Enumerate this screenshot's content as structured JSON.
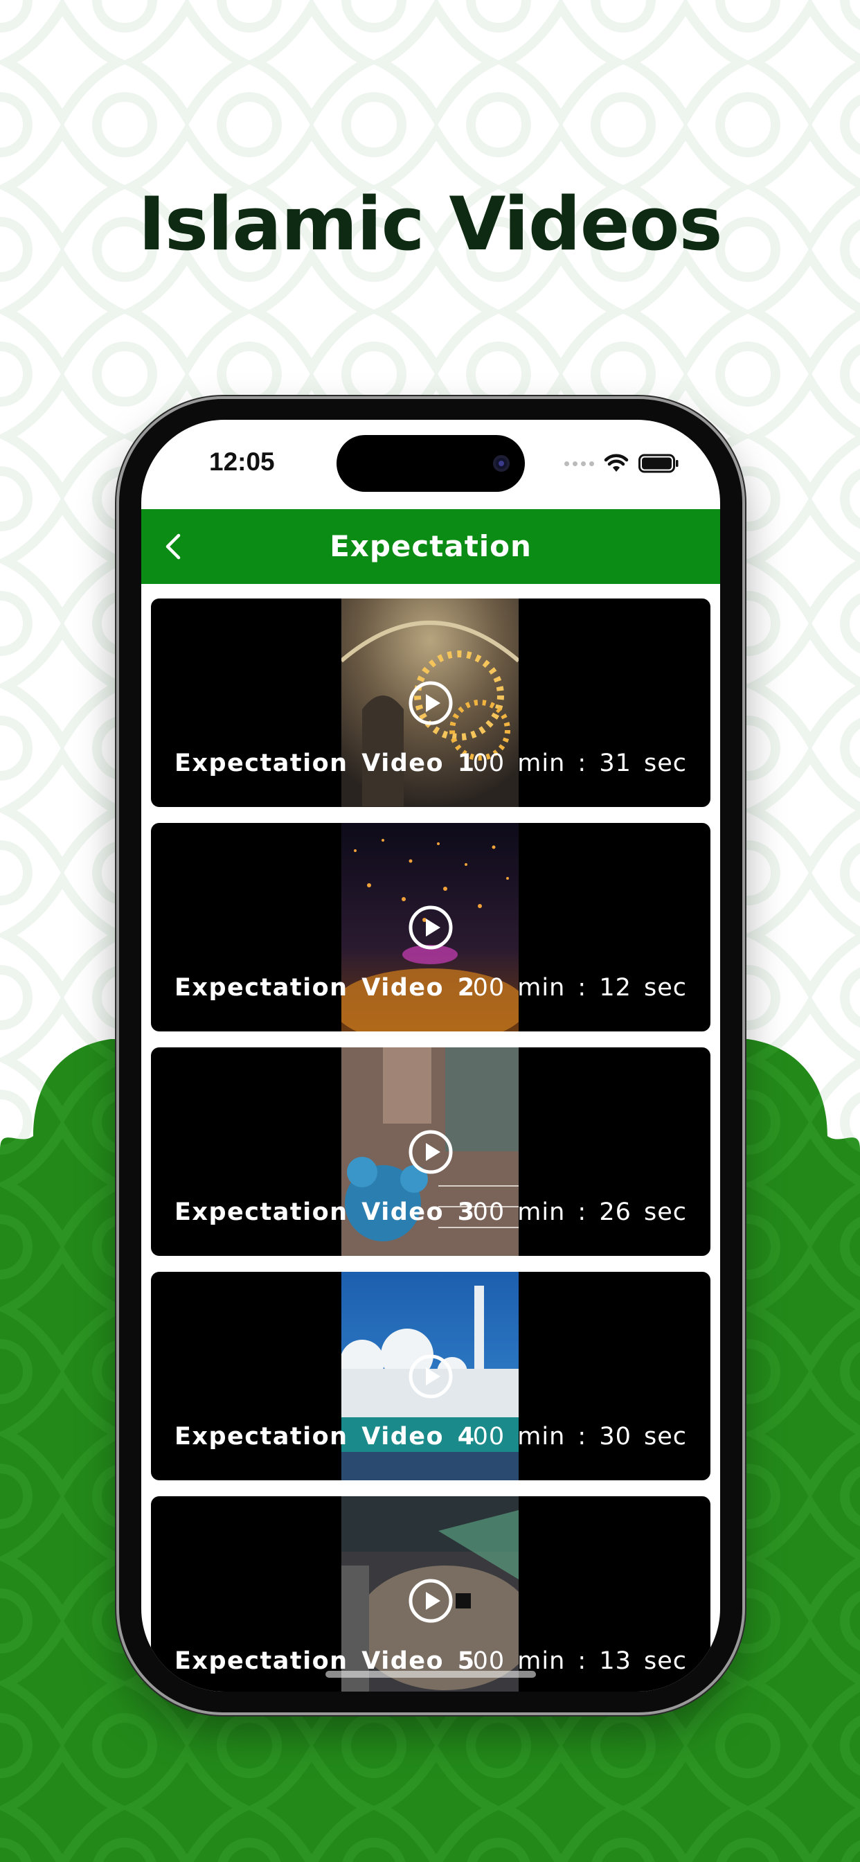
{
  "headline": "Islamic Videos",
  "colors": {
    "brand_green": "#0b8c14",
    "background_green": "#238a1a",
    "headline_color": "#0f2a12",
    "card_background": "#000000"
  },
  "status_bar": {
    "time": "12:05"
  },
  "app_bar": {
    "title": "Expectation",
    "back_icon": "chevron-left-icon"
  },
  "videos": [
    {
      "title": "Expectation Video 1",
      "duration": "00 min : 31 sec",
      "thumbnail": "mosque interior with chandelier"
    },
    {
      "title": "Expectation Video 2",
      "duration": "00 min : 12 sec",
      "thumbnail": "sky lanterns at night"
    },
    {
      "title": "Expectation Video 3",
      "duration": "00 min : 26 sec",
      "thumbnail": "aerial view of blue domed mosque"
    },
    {
      "title": "Expectation Video 4",
      "duration": "00 min : 30 sec",
      "thumbnail": "white mosque with minarets"
    },
    {
      "title": "Expectation Video 5",
      "duration": "00 min : 13 sec",
      "thumbnail": "aerial view of Kaaba courtyard"
    }
  ]
}
